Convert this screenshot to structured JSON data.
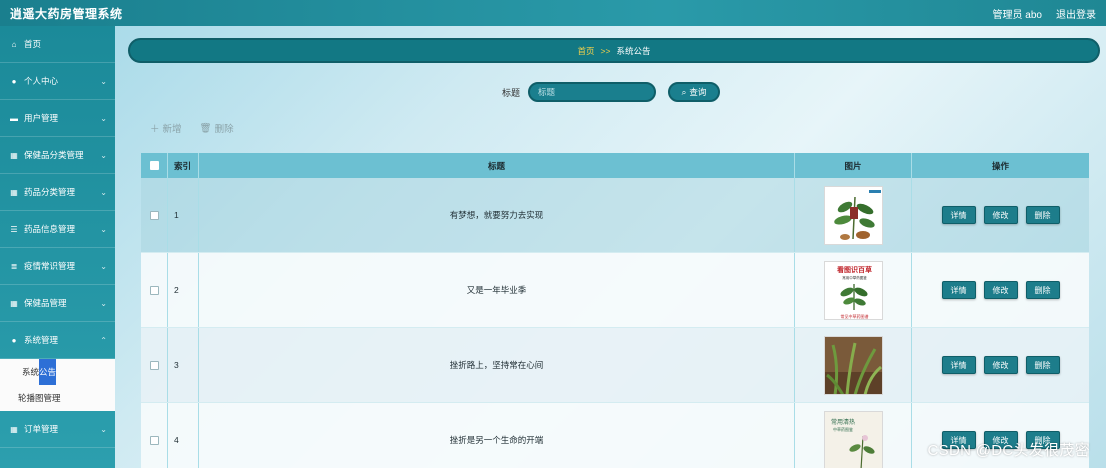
{
  "app": {
    "title": "逍遥大药房管理系统"
  },
  "header": {
    "user": "管理员 abo",
    "logout": "退出登录"
  },
  "sidebar": {
    "items": [
      {
        "label": "首页",
        "icon": "home-icon"
      },
      {
        "label": "个人中心",
        "icon": "user-icon"
      },
      {
        "label": "用户管理",
        "icon": "id-card-icon"
      },
      {
        "label": "保健品分类管理",
        "icon": "grid-icon"
      },
      {
        "label": "药品分类管理",
        "icon": "grid-icon"
      },
      {
        "label": "药品信息管理",
        "icon": "sliders-icon"
      },
      {
        "label": "疫情常识管理",
        "icon": "list-icon"
      },
      {
        "label": "保健品管理",
        "icon": "grid-icon"
      },
      {
        "label": "系统管理",
        "icon": "pin-icon"
      }
    ],
    "submenu": [
      {
        "label_prefix": "系统",
        "label_highlight": "公告"
      },
      {
        "label": "轮播图管理"
      }
    ],
    "after": {
      "label": "订单管理",
      "icon": "grid-icon"
    }
  },
  "breadcrumb": {
    "home": "首页",
    "sep": ">>",
    "current": "系统公告"
  },
  "search": {
    "label": "标题",
    "placeholder": "标题",
    "button": "查询"
  },
  "actions": {
    "add": "新增",
    "delete": "删除"
  },
  "table": {
    "headers": {
      "index": "索引",
      "title": "标题",
      "image": "图片",
      "ops": "操作"
    },
    "rows": [
      {
        "index": "1",
        "title": "有梦想，就要努力去实现"
      },
      {
        "index": "2",
        "title": "又是一年毕业季"
      },
      {
        "index": "3",
        "title": "挫折路上，坚持常在心间"
      },
      {
        "index": "4",
        "title": "挫折是另一个生命的开端"
      }
    ],
    "buttons": {
      "detail": "详情",
      "edit": "修改",
      "remove": "删除"
    }
  },
  "thumb_texts": {
    "book_title": "看图识百草",
    "book_sub": "常用中草药图鉴",
    "book_footer": "常见中草药图谱",
    "book4_title": "常用清热",
    "book4_sub": "中草药图鉴"
  },
  "watermark": "CSDN @DC头发很茂密",
  "colors": {
    "header": "#1a7f8e",
    "sidebar": "#1b8a99",
    "accent": "#127884",
    "table_header": "#6cc0d2"
  }
}
